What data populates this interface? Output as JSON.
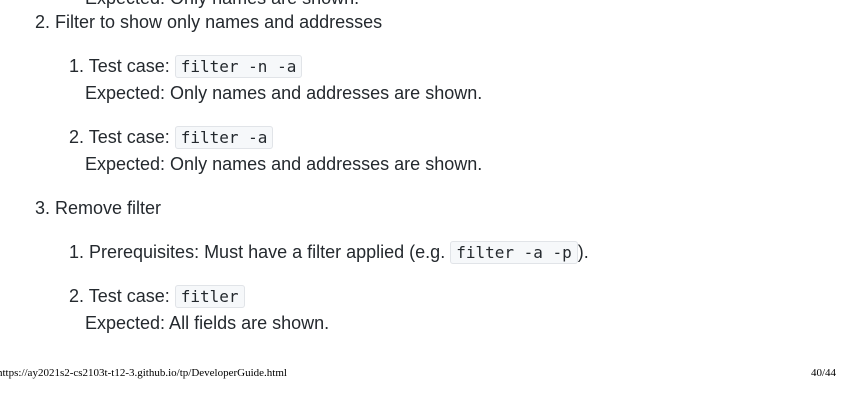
{
  "clipped_top_line": "Expected: Only names are shown.",
  "sections": [
    {
      "number": "2.",
      "title": "Filter to show only names and addresses",
      "items": [
        {
          "number": "1.",
          "label": "Test case: ",
          "code": "filter -n -a",
          "expected": "Expected: Only names and addresses are shown."
        },
        {
          "number": "2.",
          "label": "Test case: ",
          "code": "filter -a",
          "expected": "Expected: Only names and addresses are shown."
        }
      ]
    },
    {
      "number": "3.",
      "title": "Remove filter",
      "items": [
        {
          "number": "1.",
          "label": "Prerequisites: Must have a filter applied (e.g. ",
          "code": "filter -a -p",
          "suffix": ")."
        },
        {
          "number": "2.",
          "label": "Test case: ",
          "code": "fitler",
          "expected": "Expected: All fields are shown."
        }
      ]
    }
  ],
  "footer": {
    "url": "https://ay2021s2-cs2103t-t12-3.github.io/tp/DeveloperGuide.html",
    "page": "40/44"
  }
}
